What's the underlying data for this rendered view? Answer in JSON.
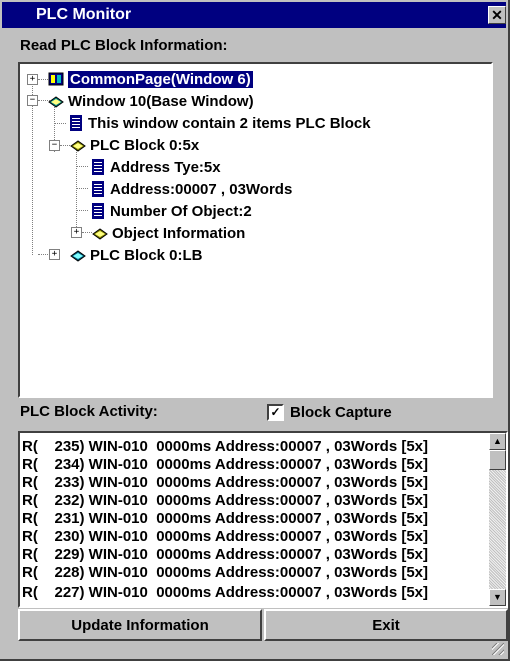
{
  "window": {
    "title": "PLC Monitor",
    "close_glyph": "✕"
  },
  "tree_section": {
    "label": "Read PLC Block Information:"
  },
  "tree": [
    {
      "text": "CommonPage(Window 6)",
      "icon": "book-icon-blue",
      "expander": "+"
    },
    {
      "text": "Window 10(Base Window)",
      "icon": "book-icon-open",
      "expander": "−"
    },
    {
      "text": "This window contain 2 items PLC Block",
      "icon": "document-icon"
    },
    {
      "text": "PLC Block 0:5x",
      "icon": "book-icon-open",
      "expander": "−"
    },
    {
      "text": "Address Tye:5x",
      "icon": "document-icon"
    },
    {
      "text": "Address:00007 , 03Words",
      "icon": "document-icon"
    },
    {
      "text": "Number Of Object:2",
      "icon": "document-icon"
    },
    {
      "text": "Object Information",
      "icon": "book-icon-open",
      "expander": "+"
    },
    {
      "text": "PLC Block 0:LB",
      "icon": "book-icon-closed",
      "expander": "+"
    }
  ],
  "activity": {
    "label": "PLC Block  Activity:",
    "capture_label": "Block Capture",
    "capture_checked": "✓"
  },
  "log": [
    "R(    235) WIN-010  0000ms Address:00007 , 03Words [5x]",
    "R(    234) WIN-010  0000ms Address:00007 , 03Words [5x]",
    "R(    233) WIN-010  0000ms Address:00007 , 03Words [5x]",
    "R(    232) WIN-010  0000ms Address:00007 , 03Words [5x]",
    "R(    231) WIN-010  0000ms Address:00007 , 03Words [5x]",
    "R(    230) WIN-010  0000ms Address:00007 , 03Words [5x]",
    "R(    229) WIN-010  0000ms Address:00007 , 03Words [5x]",
    "R(    228) WIN-010  0000ms Address:00007 , 03Words [5x]",
    "R(    227) WIN-010  0000ms Address:00007 , 03Words [5x]"
  ],
  "buttons": {
    "update": "Update Information",
    "exit": "Exit"
  },
  "colors": {
    "titlebar": "#000080",
    "face": "#c0c0c0",
    "selection": "#000080"
  }
}
